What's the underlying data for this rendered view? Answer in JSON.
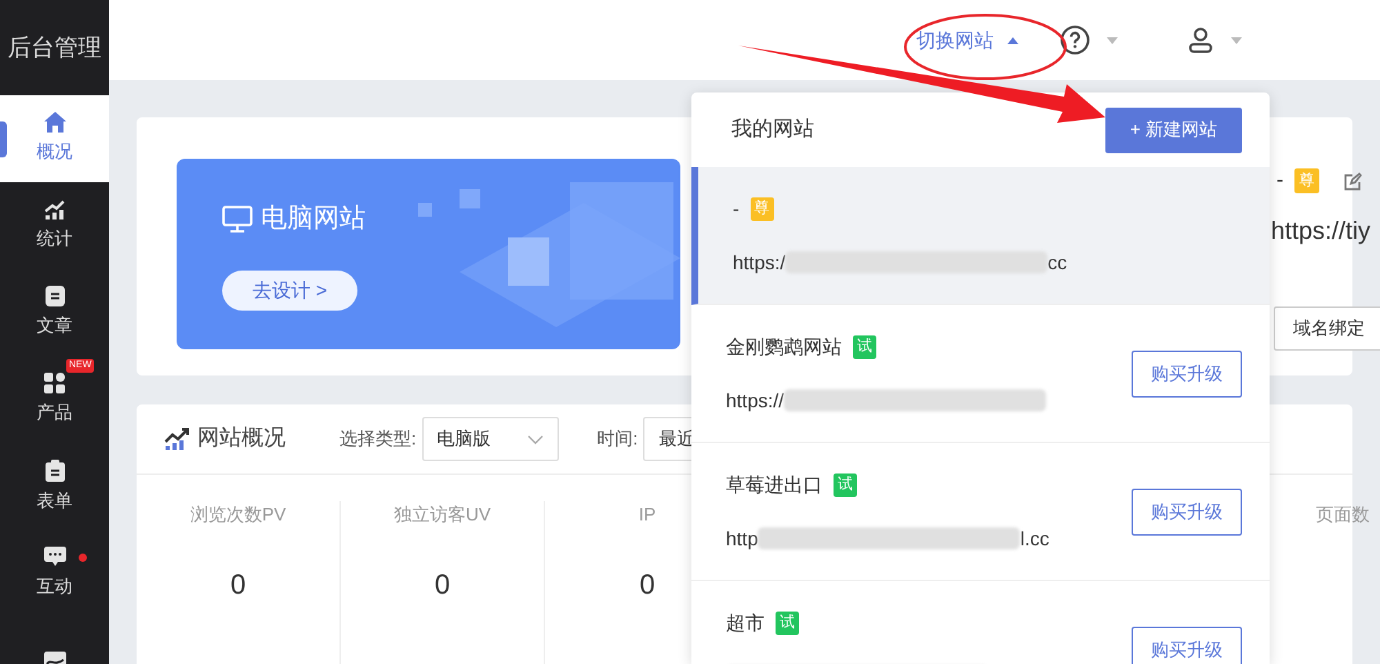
{
  "sidebar": {
    "logo": "后台管理",
    "items": [
      {
        "label": "概况",
        "selected": true
      },
      {
        "label": "统计",
        "selected": false
      },
      {
        "label": "文章",
        "selected": false
      },
      {
        "label": "产品",
        "selected": false,
        "badge": "NEW"
      },
      {
        "label": "表单",
        "selected": false
      },
      {
        "label": "互动",
        "selected": false,
        "dot": true
      },
      {
        "selected": false
      }
    ]
  },
  "header": {
    "switch_site": "切换网站",
    "switch_expanded": true
  },
  "banner": {
    "title": "电脑网站",
    "button": "去设计 >"
  },
  "current_site": {
    "name": "-",
    "tag": "尊",
    "url": "https://tiy",
    "bind_button": "域名绑定"
  },
  "overview": {
    "title": "网站概况",
    "type_label": "选择类型:",
    "type_value": "电脑版",
    "time_label": "时间:",
    "time_value": "最近",
    "stats": [
      {
        "label": "浏览次数PV",
        "value": "0"
      },
      {
        "label": "独立访客UV",
        "value": "0"
      },
      {
        "label": "IP",
        "value": "0"
      },
      {
        "label": "页面数"
      }
    ]
  },
  "dropdown": {
    "title": "我的网站",
    "new_button": "+ 新建网站",
    "sites": [
      {
        "name": "-",
        "tag": "尊",
        "kind": "premium",
        "url_start": "https:/",
        "url_end": "cc",
        "selected": true
      },
      {
        "name": "金刚鹦鹉网站",
        "tag": "试",
        "kind": "trial",
        "url_start": "https://",
        "selected": false,
        "button": "购买升级"
      },
      {
        "name": "草莓进出口",
        "tag": "试",
        "kind": "trial",
        "url_start": "http",
        "url_end": "l.cc",
        "selected": false,
        "button": "购买升级"
      },
      {
        "name": "超市",
        "tag": "试",
        "kind": "trial",
        "selected": false,
        "button": "购买升级"
      }
    ]
  }
}
